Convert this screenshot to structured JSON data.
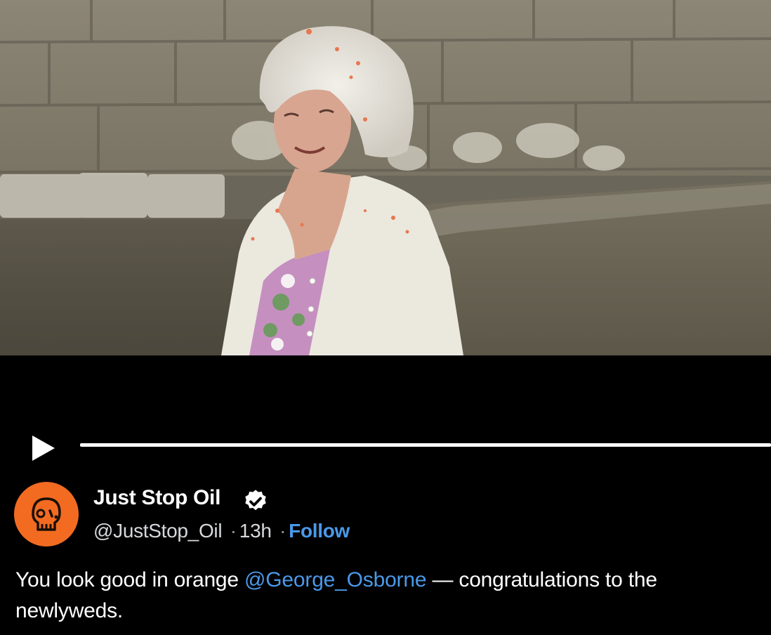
{
  "video": {
    "controls": {
      "play_icon": "play-icon",
      "progress": 0
    }
  },
  "tweet": {
    "author": {
      "display_name": "Just Stop Oil",
      "handle": "@JustStop_Oil",
      "verified": true,
      "verified_icon": "verified-badge-icon",
      "avatar_icon": "skull-icon",
      "avatar_color": "#f26b21"
    },
    "meta": {
      "separator": "·",
      "time": "13h",
      "follow_label": "Follow"
    },
    "text": {
      "before": "You look good in orange ",
      "mention": "@George_Osborne",
      "after": " — congratulations to the newlyweds."
    }
  },
  "colors": {
    "background": "#000000",
    "link": "#4a99e9",
    "secondary_text": "#d6d9dc"
  }
}
